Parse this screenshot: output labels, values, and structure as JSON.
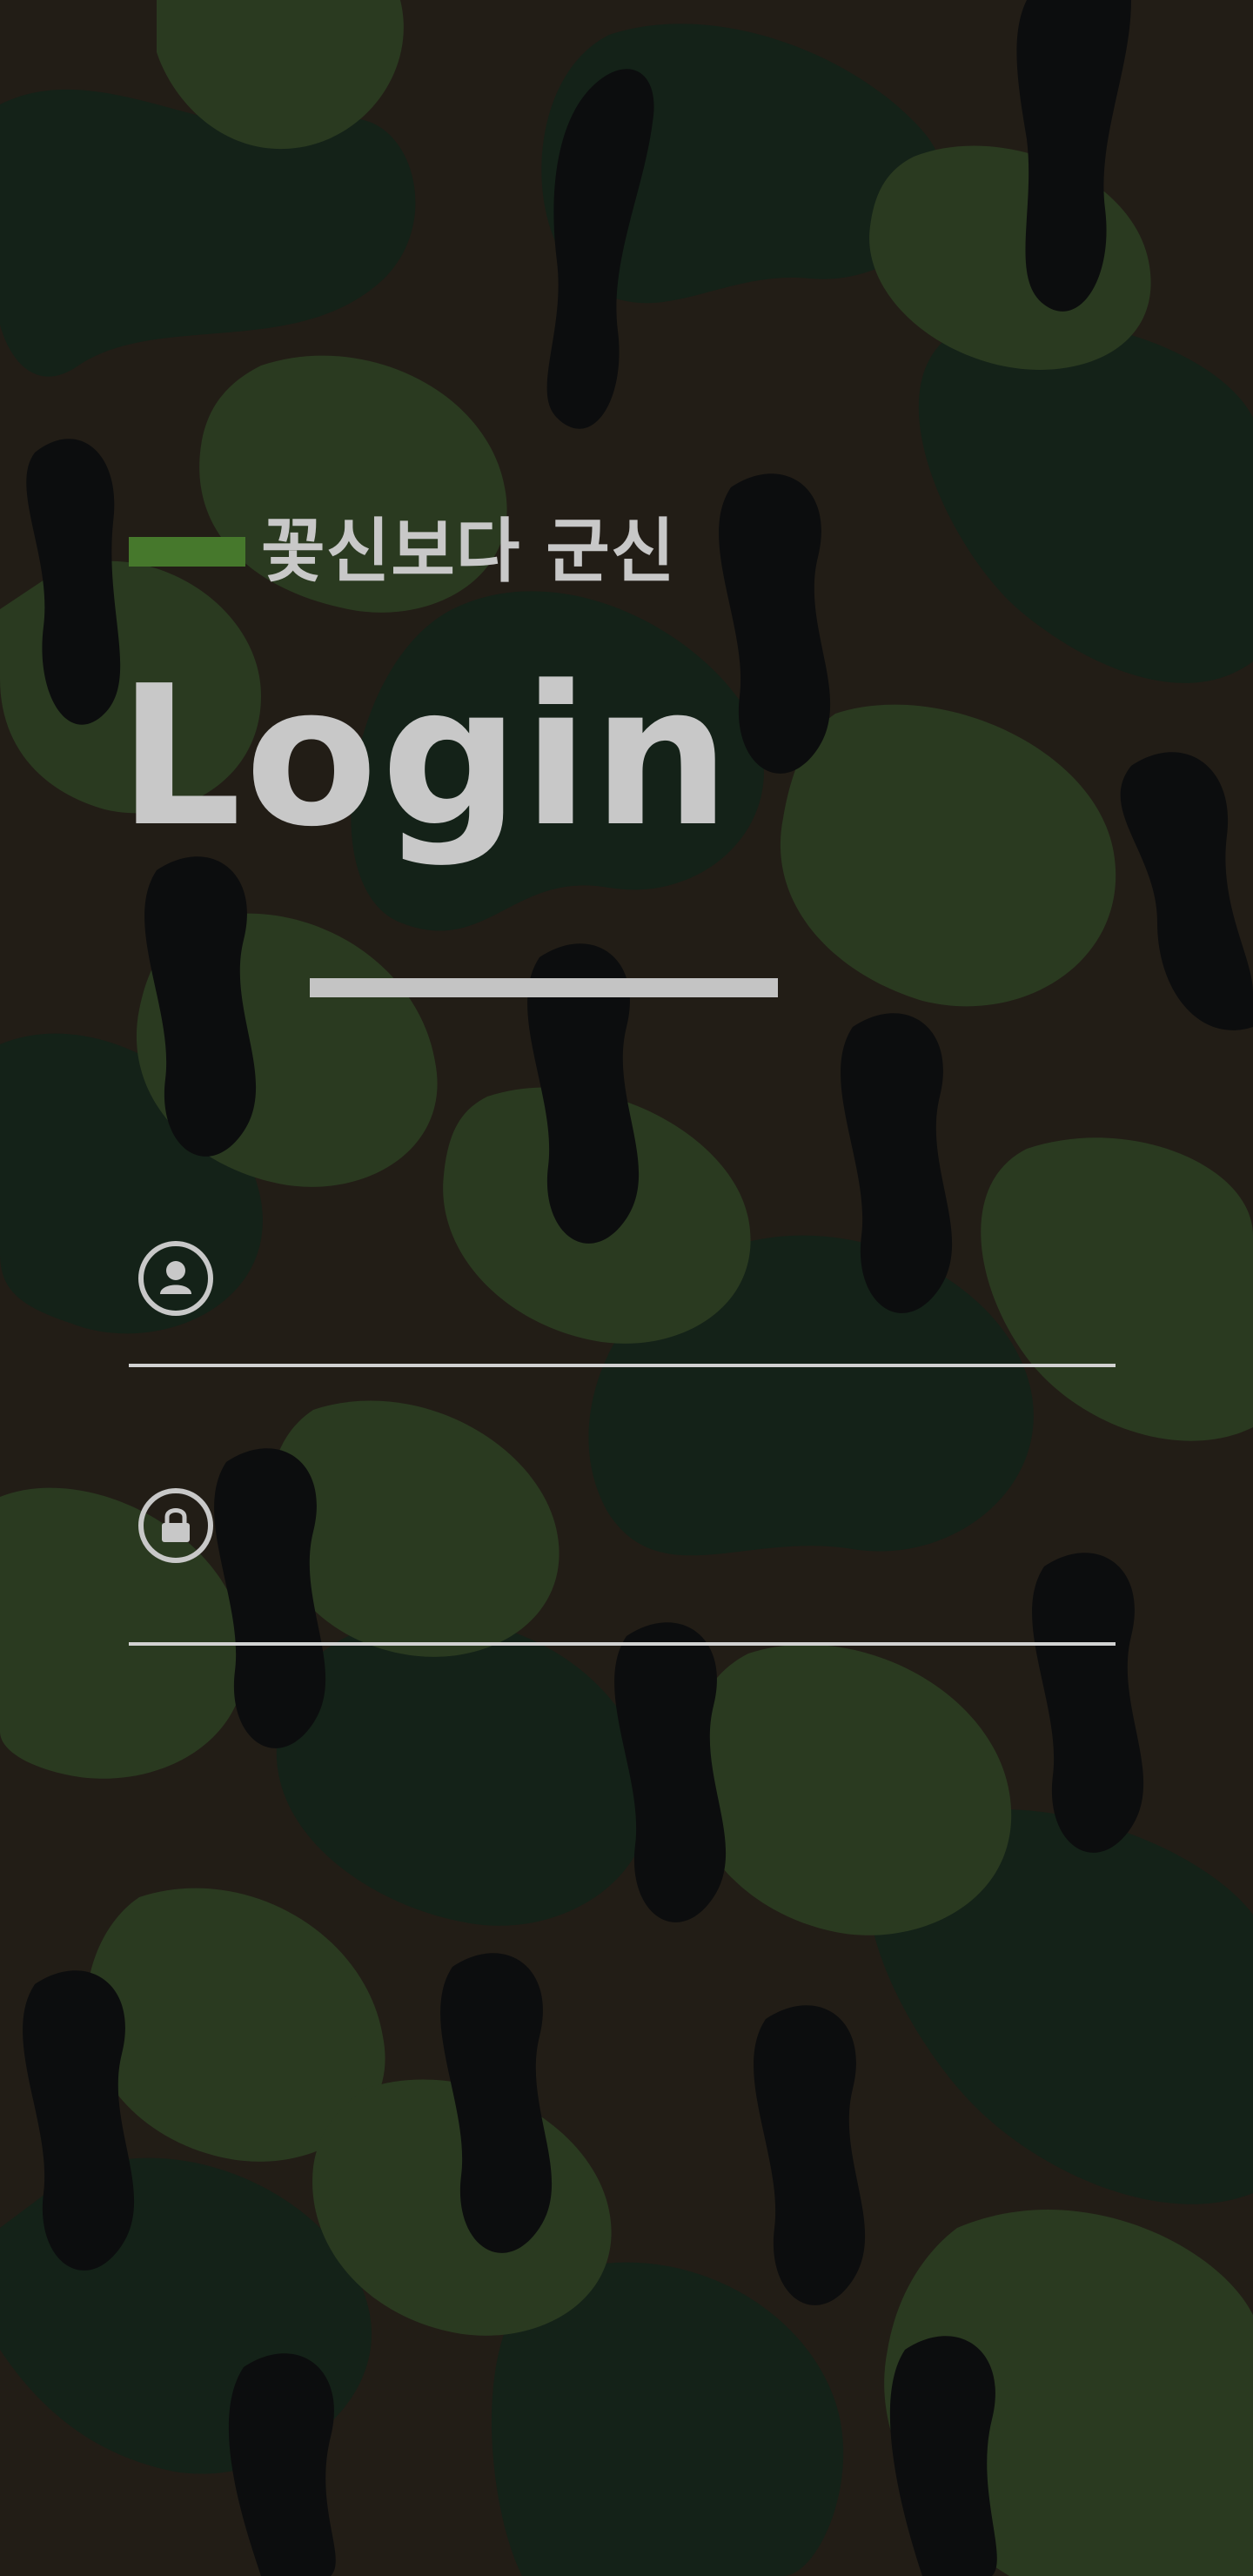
{
  "header": {
    "tagline": "꽃신보다 군신",
    "title": "Login"
  },
  "form": {
    "username": {
      "icon": "user-circle-icon",
      "value": "",
      "placeholder": ""
    },
    "password": {
      "icon": "lock-circle-icon",
      "value": "",
      "placeholder": ""
    }
  },
  "colors": {
    "accent": "#46782c",
    "text": "#c8c8c8",
    "camo_dark": "#0c0d0e",
    "camo_green": "#2a3a20",
    "camo_deep_green": "#142218",
    "camo_brown": "#231e16"
  }
}
